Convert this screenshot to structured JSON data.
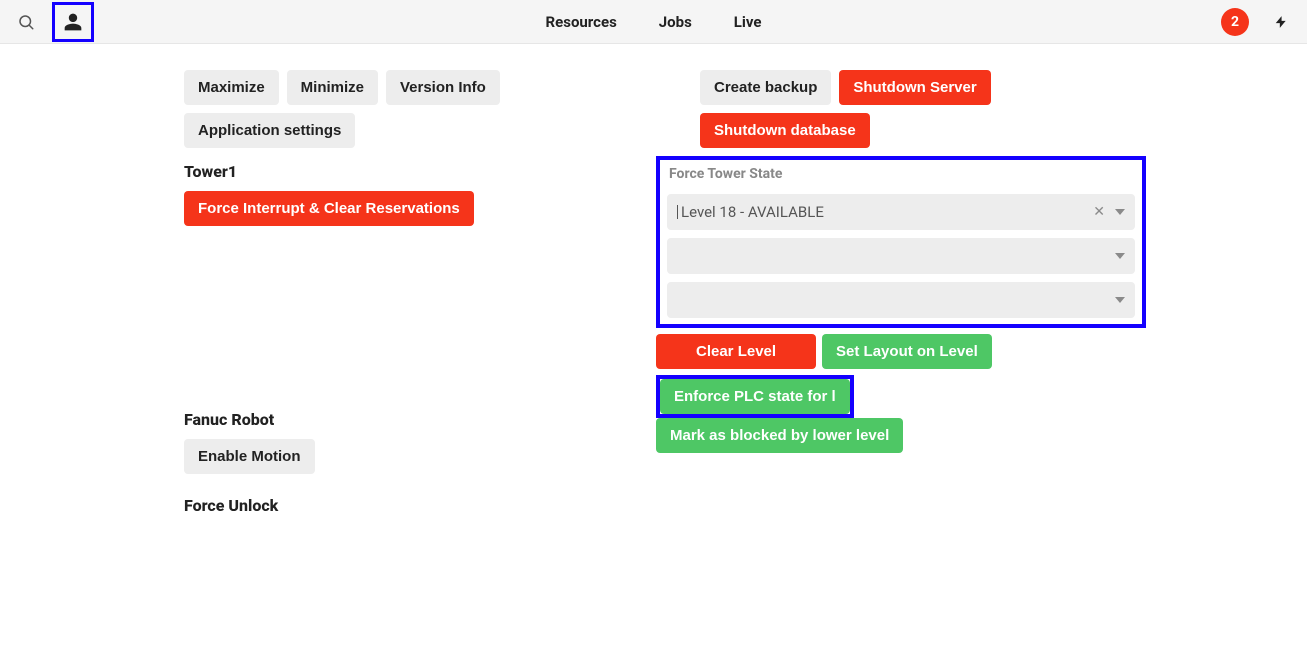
{
  "nav": {
    "resources": "Resources",
    "jobs": "Jobs",
    "live": "Live"
  },
  "notifications": {
    "count": "2"
  },
  "leftColumn": {
    "settingsButtons": {
      "maximize": "Maximize",
      "minimize": "Minimize",
      "versionInfo": "Version Info",
      "appSettings": "Application settings"
    },
    "tower": {
      "title": "Tower1",
      "forceInterrupt": "Force Interrupt & Clear Reservations"
    },
    "fanuc": {
      "title": "Fanuc Robot",
      "enableMotion": "Enable Motion"
    },
    "forceUnlock": {
      "title": "Force Unlock"
    }
  },
  "rightColumn": {
    "backupRow": {
      "createBackup": "Create backup",
      "shutdownServer": "Shutdown Server",
      "shutdownDatabase": "Shutdown database"
    },
    "forceTowerState": {
      "label": "Force Tower State",
      "levelSelectValue": "Level 18 - AVAILABLE",
      "clearLevel": "Clear Level",
      "setLayout": "Set Layout on Level",
      "enforcePlc": "Enforce PLC state for l",
      "markBlocked": "Mark as blocked by lower level"
    }
  }
}
